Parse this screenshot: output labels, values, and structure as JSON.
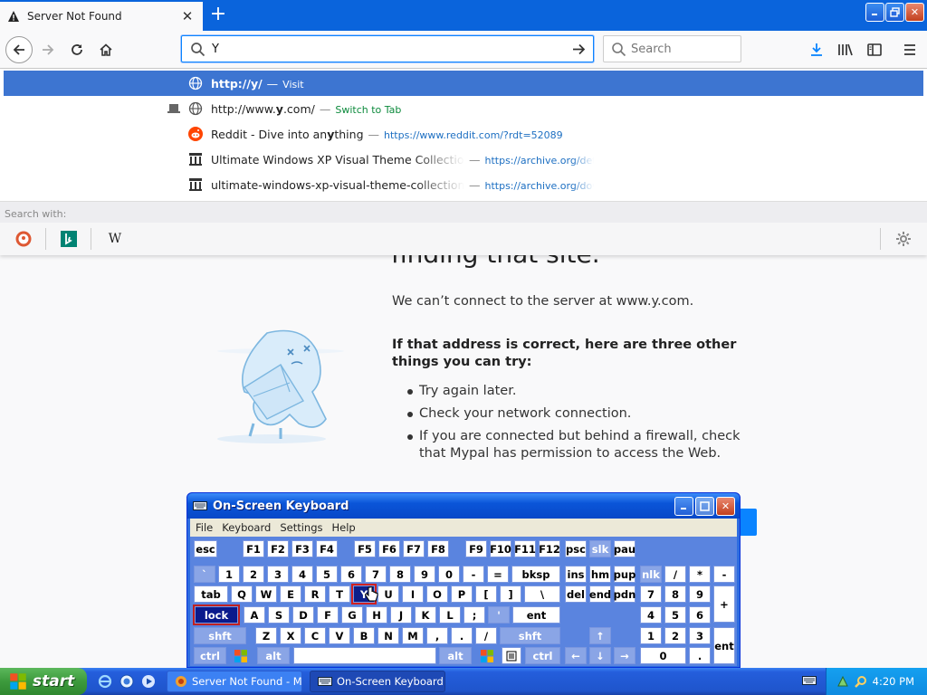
{
  "window": {
    "title": "Server Not Found"
  },
  "tabs": [
    {
      "label": "Server Not Found"
    }
  ],
  "toolbar": {
    "url_value": "Y",
    "search_placeholder": "Search"
  },
  "dropdown": {
    "rows": [
      {
        "text_prefix": "http://",
        "text_bold": "y",
        "text_suffix": "/",
        "sep": "—",
        "action": "Visit",
        "icon": "globe-icon"
      },
      {
        "text_prefix": "http://www.",
        "text_bold": "y",
        "text_suffix": ".com/",
        "sep": "—",
        "action": "Switch to Tab",
        "icon": "globe-icon"
      },
      {
        "text_prefix": "Reddit - Dive into an",
        "text_bold": "y",
        "text_suffix": "thing",
        "sep": "—",
        "url": "https://www.reddit.com/?rdt=52089",
        "icon": "reddit-icon"
      },
      {
        "text": "Ultimate Windows XP Visual Theme Collection :",
        "sep": "—",
        "url": "https://archive.org/deta",
        "icon": "archive-icon"
      },
      {
        "text": "ultimate-windows-xp-visual-theme-collection dir",
        "sep": "—",
        "url": "https://archive.org/dow",
        "icon": "archive-icon"
      }
    ],
    "search_with_label": "Search with:",
    "engines": [
      "duckduckgo-icon",
      "bing-icon",
      "wikipedia-icon"
    ],
    "wikipedia_letter": "W"
  },
  "page": {
    "heading": "finding that site.",
    "cant_connect": "We can’t connect to the server at www.y.com.",
    "if_correct": "If that address is correct, here are three other things you can try:",
    "suggestions": [
      "Try again later.",
      "Check your network connection.",
      "If you are connected but behind a firewall, check that Mypal has permission to access the Web."
    ]
  },
  "osk": {
    "title": "On-Screen Keyboard",
    "menu": [
      "File",
      "Keyboard",
      "Settings",
      "Help"
    ],
    "rows": [
      [
        "esc",
        "F1",
        "F2",
        "F3",
        "F4",
        "F5",
        "F6",
        "F7",
        "F8",
        "F9",
        "F10",
        "F11",
        "F12",
        "psc",
        "slk",
        "pau"
      ],
      [
        "`",
        "1",
        "2",
        "3",
        "4",
        "5",
        "6",
        "7",
        "8",
        "9",
        "0",
        "-",
        "=",
        "bksp",
        "ins",
        "hm",
        "pup",
        "nlk",
        "/",
        "*",
        "-"
      ],
      [
        "tab",
        "Q",
        "W",
        "E",
        "R",
        "T",
        "Y",
        "U",
        "I",
        "O",
        "P",
        "[",
        "]",
        "\\",
        "del",
        "end",
        "pdn",
        "7",
        "8",
        "9",
        "+"
      ],
      [
        "lock",
        "A",
        "S",
        "D",
        "F",
        "G",
        "H",
        "J",
        "K",
        "L",
        ";",
        "'",
        "ent",
        "4",
        "5",
        "6"
      ],
      [
        "shft",
        "Z",
        "X",
        "C",
        "V",
        "B",
        "N",
        "M",
        ",",
        ".",
        "/",
        "shft",
        "1",
        "2",
        "3",
        "ent"
      ],
      [
        "ctrl",
        "alt",
        "",
        "alt",
        "ctrl",
        "0",
        "."
      ]
    ],
    "highlighted_key": "Y",
    "active_key": "lock"
  },
  "taskbar": {
    "start_label": "start",
    "tasks": [
      {
        "label": "Server Not Found - M...",
        "active": false
      },
      {
        "label": "On-Screen Keyboard",
        "active": true
      }
    ],
    "clock": "4:20 PM"
  },
  "colors": {
    "accent": "#0a84ff",
    "xp_blue": "#245edc",
    "selected_row": "#3d75d1"
  }
}
